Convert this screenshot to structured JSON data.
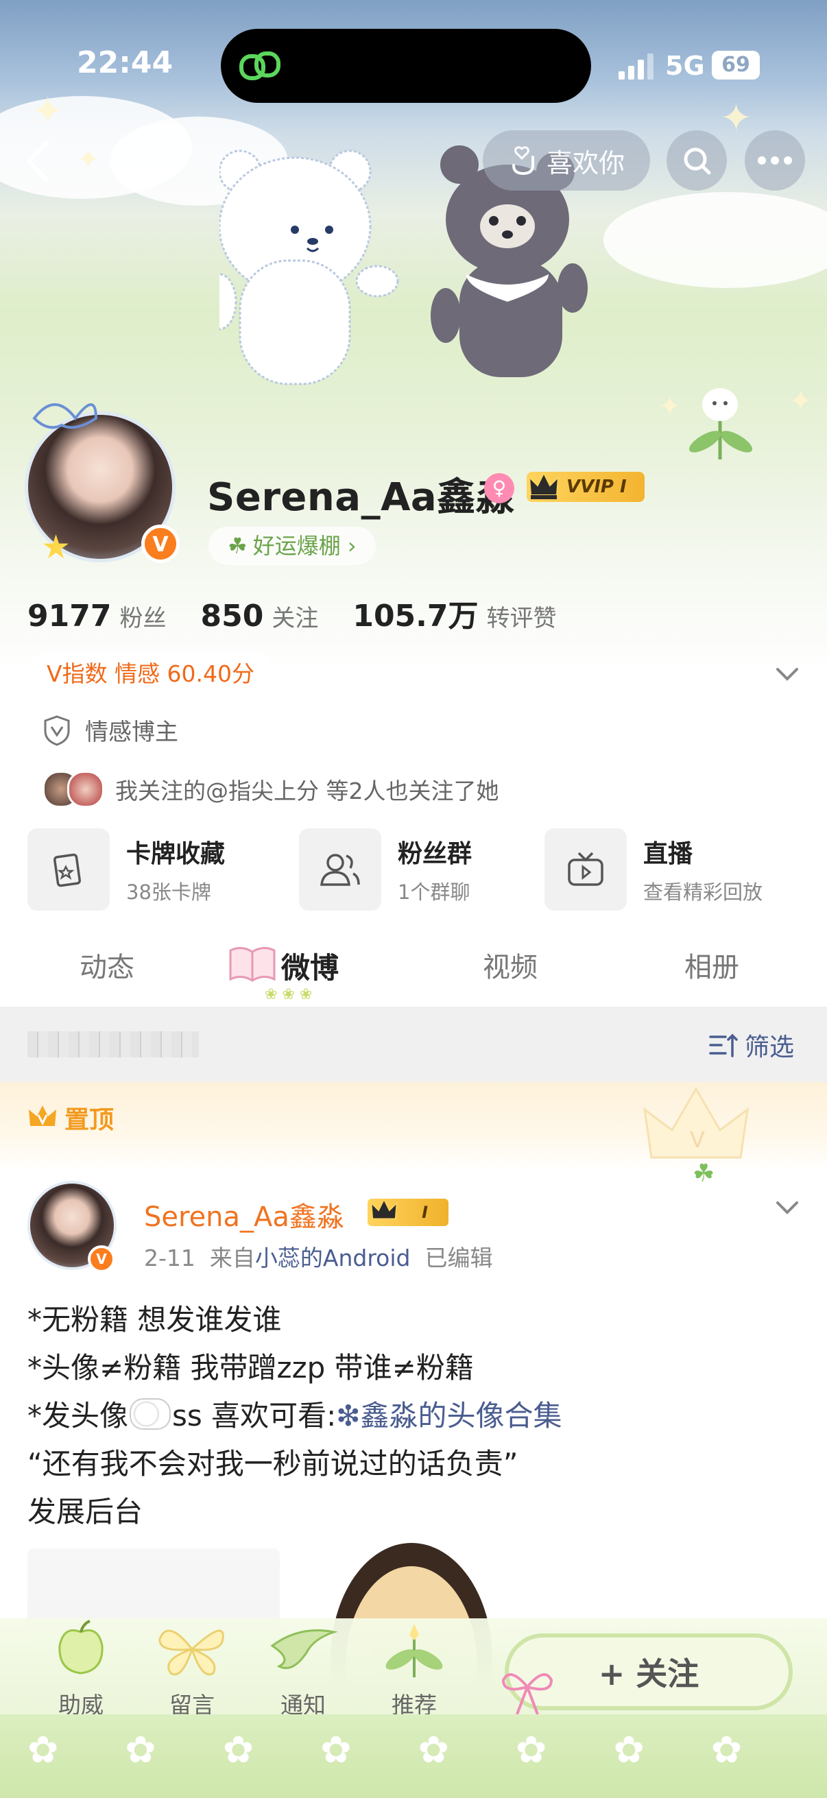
{
  "status_bar": {
    "time": "22:44",
    "network": "5G",
    "battery": "69"
  },
  "header": {
    "like_label": "喜欢你"
  },
  "profile": {
    "name": "Serena_Aa鑫淼",
    "vvip_badge": "VVIP I",
    "luck_tag": "好运爆棚 ›",
    "stats": [
      {
        "value": "9177",
        "label": "粉丝"
      },
      {
        "value": "850",
        "label": "关注"
      },
      {
        "value": "105.7万",
        "label": "转评赞"
      }
    ],
    "v_index": "V指数 情感 60.40分",
    "blogger_type": "情感博主",
    "mutual": "我关注的@指尖上分 等2人也关注了她"
  },
  "features": [
    {
      "title": "卡牌收藏",
      "subtitle": "38张卡牌"
    },
    {
      "title": "粉丝群",
      "subtitle": "1个群聊"
    },
    {
      "title": "直播",
      "subtitle": "查看精彩回放"
    }
  ],
  "tabs": [
    {
      "label": "动态"
    },
    {
      "label": "微博"
    },
    {
      "label": "视频"
    },
    {
      "label": "相册"
    }
  ],
  "filter": {
    "label": "筛选"
  },
  "pinned": {
    "label": "置顶"
  },
  "post": {
    "author": "Serena_Aa鑫淼",
    "badge": "I",
    "date": "2-11",
    "source_prefix": "来自",
    "source": "小蕊的Android",
    "edited": "已编辑",
    "lines": [
      "*无粉籍 想发谁发谁",
      "*头像≠粉籍 我带蹭zzp 带谁≠粉籍",
      "*发头像",
      "ss 喜欢可看:",
      "鑫淼的头像合集",
      "“还有我不会对我一秒前说过的话负责”",
      "发展后台"
    ]
  },
  "bottom_nav": {
    "items": [
      {
        "label": "助威",
        "icon": "apple-icon"
      },
      {
        "label": "留言",
        "icon": "butterfly-icon"
      },
      {
        "label": "通知",
        "icon": "bird-icon"
      },
      {
        "label": "推荐",
        "icon": "flower-icon"
      }
    ],
    "follow": "+ 关注"
  },
  "colors": {
    "accent_orange": "#f07320",
    "link_blue": "#4a5d90",
    "vvip_gold": "#f3b430",
    "verified_orange": "#fa7d1e"
  }
}
